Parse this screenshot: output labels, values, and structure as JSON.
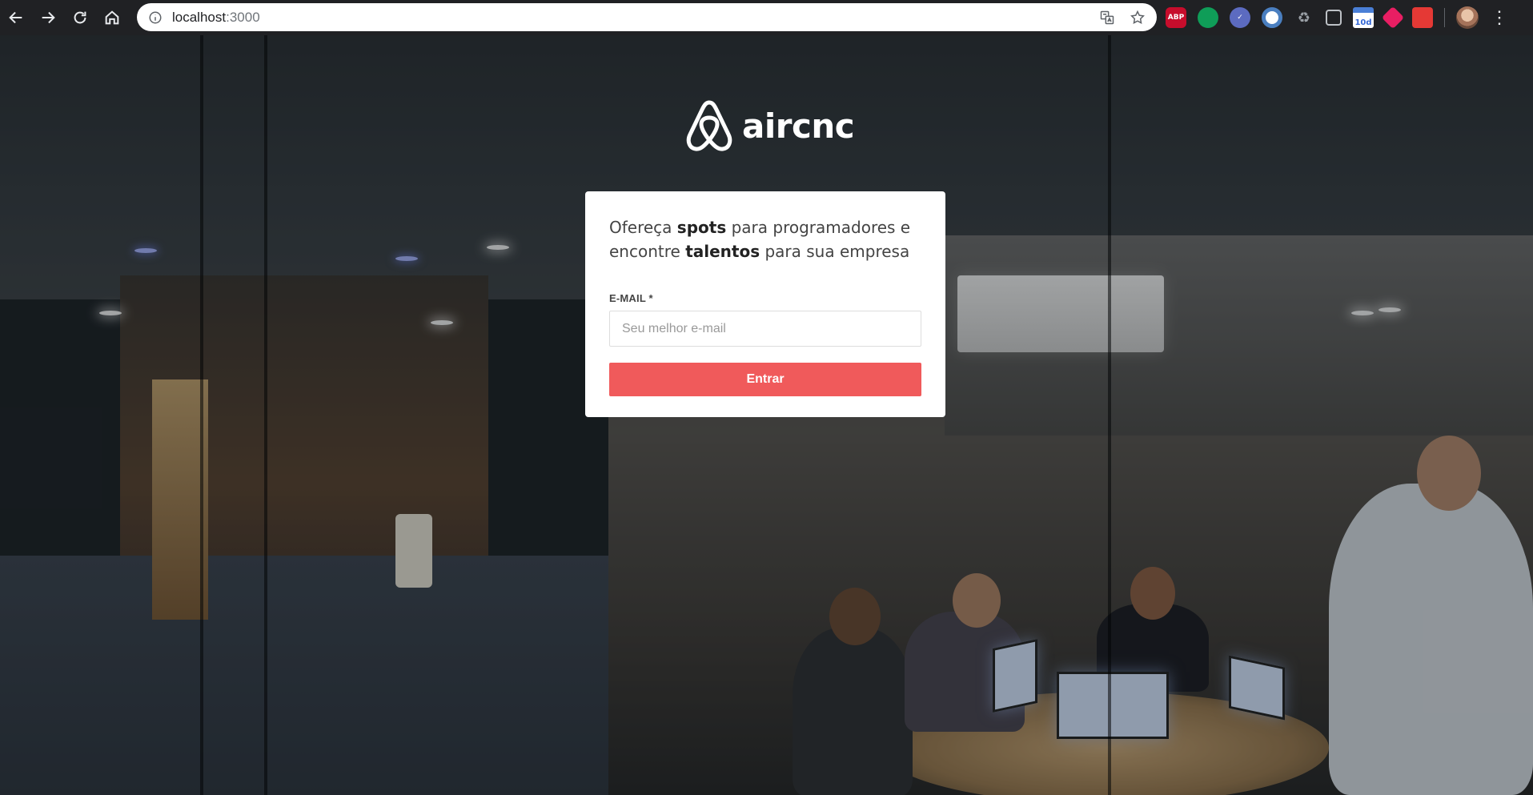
{
  "browser": {
    "url_host": "localhost",
    "url_port": ":3000",
    "extensions": [
      {
        "name": "adblock-plus-icon",
        "label": "ABP"
      },
      {
        "name": "green-extension-icon",
        "label": ""
      },
      {
        "name": "checkmark-extension-icon",
        "label": ""
      },
      {
        "name": "blue-ring-extension-icon",
        "label": ""
      },
      {
        "name": "recycle-extension-icon",
        "label": ""
      },
      {
        "name": "lightbulb-extension-icon",
        "label": ""
      },
      {
        "name": "calendar-extension-icon",
        "label": "10d"
      },
      {
        "name": "pink-extension-icon",
        "label": ""
      },
      {
        "name": "red-extension-icon",
        "label": ""
      }
    ]
  },
  "logo": {
    "text": "aircnc"
  },
  "card": {
    "headline_part1": "Ofereça ",
    "headline_bold1": "spots",
    "headline_part2": " para programadores e encontre ",
    "headline_bold2": "talentos",
    "headline_part3": " para sua empresa",
    "email_label": "E-MAIL *",
    "email_placeholder": "Seu melhor e-mail",
    "email_value": "",
    "submit_label": "Entrar"
  },
  "colors": {
    "accent": "#f05a5b",
    "card_bg": "#ffffff",
    "text": "#444444",
    "chrome_bg": "#202124"
  }
}
